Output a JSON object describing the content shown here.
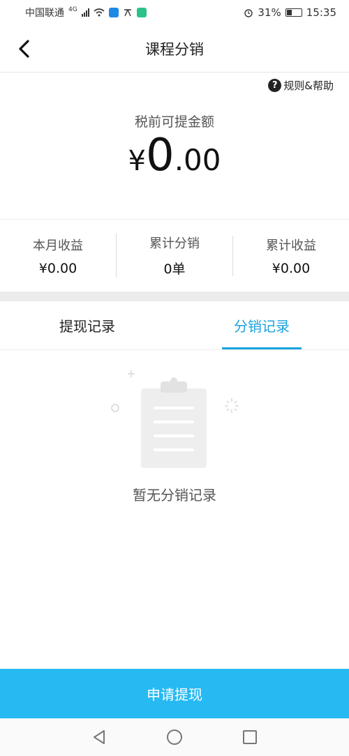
{
  "status_bar": {
    "carrier": "中国联通",
    "network": "4G",
    "battery": "31%",
    "time": "15:35"
  },
  "header": {
    "title": "课程分销"
  },
  "help": {
    "label": "规则&帮助"
  },
  "balance": {
    "label": "税前可提金额",
    "currency": "¥",
    "integer": "0",
    "decimal": ".00"
  },
  "stats": [
    {
      "label": "本月收益",
      "value": "¥0.00"
    },
    {
      "label": "累计分销",
      "value": "0单"
    },
    {
      "label": "累计收益",
      "value": "¥0.00"
    }
  ],
  "tabs": [
    {
      "label": "提现记录",
      "active": false
    },
    {
      "label": "分销记录",
      "active": true
    }
  ],
  "empty_state": {
    "message": "暂无分销记录"
  },
  "footer": {
    "apply_label": "申请提现"
  },
  "colors": {
    "accent": "#1aa3e0",
    "button": "#27b9f2"
  },
  "icons": {
    "back": "back-arrow-icon",
    "help": "question-circle-icon",
    "empty": "clipboard-icon",
    "nav_back": "triangle-back-icon",
    "nav_home": "circle-home-icon",
    "nav_recent": "square-recent-icon"
  }
}
